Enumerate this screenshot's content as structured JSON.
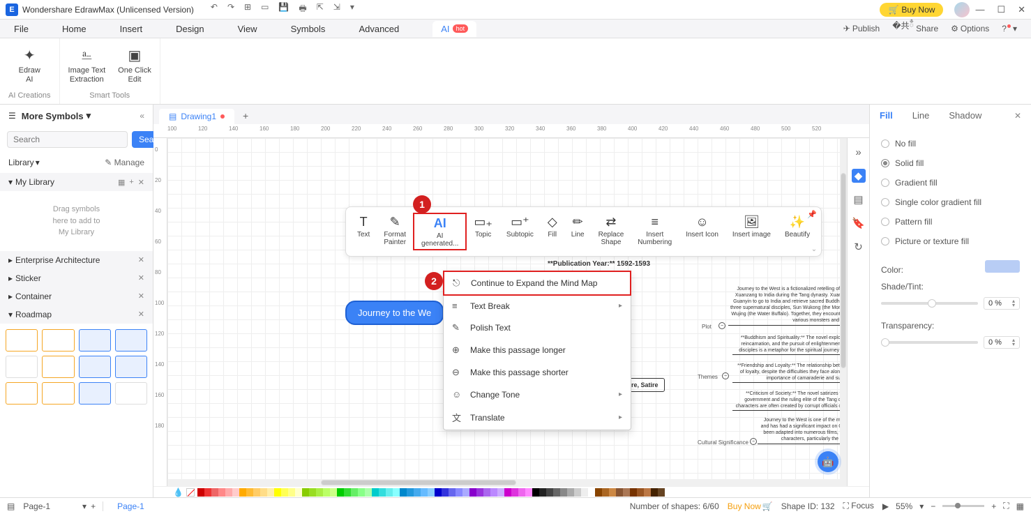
{
  "titlebar": {
    "app_title": "Wondershare EdrawMax (Unlicensed Version)",
    "buy_now": "Buy Now"
  },
  "menubar": {
    "items": [
      "File",
      "Home",
      "Insert",
      "Design",
      "View",
      "Symbols",
      "Advanced"
    ],
    "ai_tab": "AI",
    "hot": "hot",
    "publish": "Publish",
    "share": "Share",
    "options": "Options"
  },
  "ribbon": {
    "groups": [
      {
        "label": "AI Creations",
        "items": [
          {
            "icon": "✦",
            "text": "Edraw\nAI"
          }
        ]
      },
      {
        "label": "Smart Tools",
        "items": [
          {
            "icon": "⎁",
            "text": "Image Text\nExtraction"
          },
          {
            "icon": "▣",
            "text": "One Click\nEdit"
          }
        ]
      }
    ]
  },
  "left": {
    "more_symbols": "More Symbols",
    "search_placeholder": "Search",
    "search_btn": "Search",
    "library": "Library",
    "manage": "Manage",
    "my_library": "My Library",
    "dropzone": "Drag symbols\nhere to add to\nMy Library",
    "sections": [
      "Enterprise Architecture",
      "Sticker",
      "Container",
      "Roadmap"
    ]
  },
  "tab": {
    "name": "Drawing1"
  },
  "float_toolbar": {
    "items": [
      {
        "icon": "T",
        "label": "Text"
      },
      {
        "icon": "✎",
        "label": "Format\nPainter"
      },
      {
        "icon": "AI",
        "label": "AI\ngenerated...",
        "hl": true
      },
      {
        "icon": "▭",
        "label": "Topic"
      },
      {
        "icon": "▭",
        "label": "Subtopic"
      },
      {
        "icon": "◇",
        "label": "Fill"
      },
      {
        "icon": "/",
        "label": "Line"
      },
      {
        "icon": "⇄",
        "label": "Replace\nShape"
      },
      {
        "icon": "≡",
        "label": "Insert\nNumbering"
      },
      {
        "icon": "▦",
        "label": "Insert Icon"
      },
      {
        "icon": "▦",
        "label": "Insert image"
      },
      {
        "icon": "✧",
        "label": "Beautify"
      }
    ]
  },
  "ctx_menu": {
    "items": [
      {
        "icon": "⎋",
        "label": "Continue to Expand the Mind Map",
        "hl": true
      },
      {
        "icon": "≡",
        "label": "Text Break",
        "arrow": true
      },
      {
        "icon": "✎",
        "label": "Polish Text"
      },
      {
        "icon": "⊕",
        "label": "Make this passage longer"
      },
      {
        "icon": "⊖",
        "label": "Make this passage shorter"
      },
      {
        "icon": "☺",
        "label": "Change Tone",
        "arrow": true
      },
      {
        "icon": "文",
        "label": "Translate",
        "arrow": true
      }
    ]
  },
  "callouts": {
    "1": "1",
    "2": "2"
  },
  "mindmap": {
    "root": "Journey to the We",
    "pub_year": "**Publication Year:** 1592-1593",
    "plot_label": "Plot",
    "themes_label": "Themes",
    "genre": "iture, Satire",
    "cultural_sig_label": "Cultural Significance",
    "plot_text": "Journey to the West is a fictionalized retelling of the pilgrimage of the Buddhist monk Xuanzang to India during the Tang dynasty. Xuanzang is instructed by the Bodhisattva Guanyin to go to India and retrieve sacred Buddhist texts. Along the way, he is joined by three supernatural disciples, Sun Wukong (the Monkey King), Zhu Bajie (the Pig), and Sha Wujing (the Water Buffalo). Together, they encounter obstacles and engage in battles with various monsters and evil spirits.",
    "theme1": "**Buddhism and Spirituality:** The novel explores Buddhist concepts such as karma, reincarnation, and the pursuit of enlightenment. The pilgrimage of Xuanzang and his disciples is a metaphor for the spiritual journey of an individual seeking enlightenment.",
    "theme2": "**Friendship and Loyalty:** The relationship between Xuanzang and his disciples is one of loyalty, despite the difficulties they face along the way. The novel demonstrates the importance of camaraderie and support on a difficult journey.",
    "theme3": "**Criticism of Society:** The novel satirizes the corruption and hypocrisy of the government and the ruling elite of the Tang dynasty. The obstacles faced by the characters are often created by corrupt officials or evil spirits who represent societal ills.",
    "cultural_text": "Journey to the West is one of the most important works of literature in Chinese culture and has had a significant impact on Chinese art, film, and popular culture. The novel has been adapted into numerous films, television series, and video games, and its popular characters, particularly the Monkey King, have become cultural icons."
  },
  "props": {
    "tabs": [
      "Fill",
      "Line",
      "Shadow"
    ],
    "fill_options": [
      "No fill",
      "Solid fill",
      "Gradient fill",
      "Single color gradient fill",
      "Pattern fill",
      "Picture or texture fill"
    ],
    "color_label": "Color:",
    "shade_label": "Shade/Tint:",
    "transparency_label": "Transparency:",
    "shade_val": "0 %",
    "trans_val": "0 %"
  },
  "statusbar": {
    "page_dd": "Page-1",
    "page_tab": "Page-1",
    "shapes": "Number of shapes: 6/60",
    "buy_now": "Buy Now",
    "shape_id": "Shape ID: 132",
    "focus": "Focus",
    "zoom": "55%"
  },
  "ruler_h_ticks": [
    "100",
    "120",
    "140",
    "160",
    "180",
    "200",
    "220",
    "240",
    "260",
    "280",
    "300",
    "320",
    "340",
    "360",
    "380",
    "400",
    "420",
    "440",
    "460",
    "480",
    "500",
    "520"
  ],
  "ruler_v_ticks": [
    "0",
    "20",
    "40",
    "60",
    "80",
    "100",
    "120",
    "140",
    "160",
    "180"
  ]
}
